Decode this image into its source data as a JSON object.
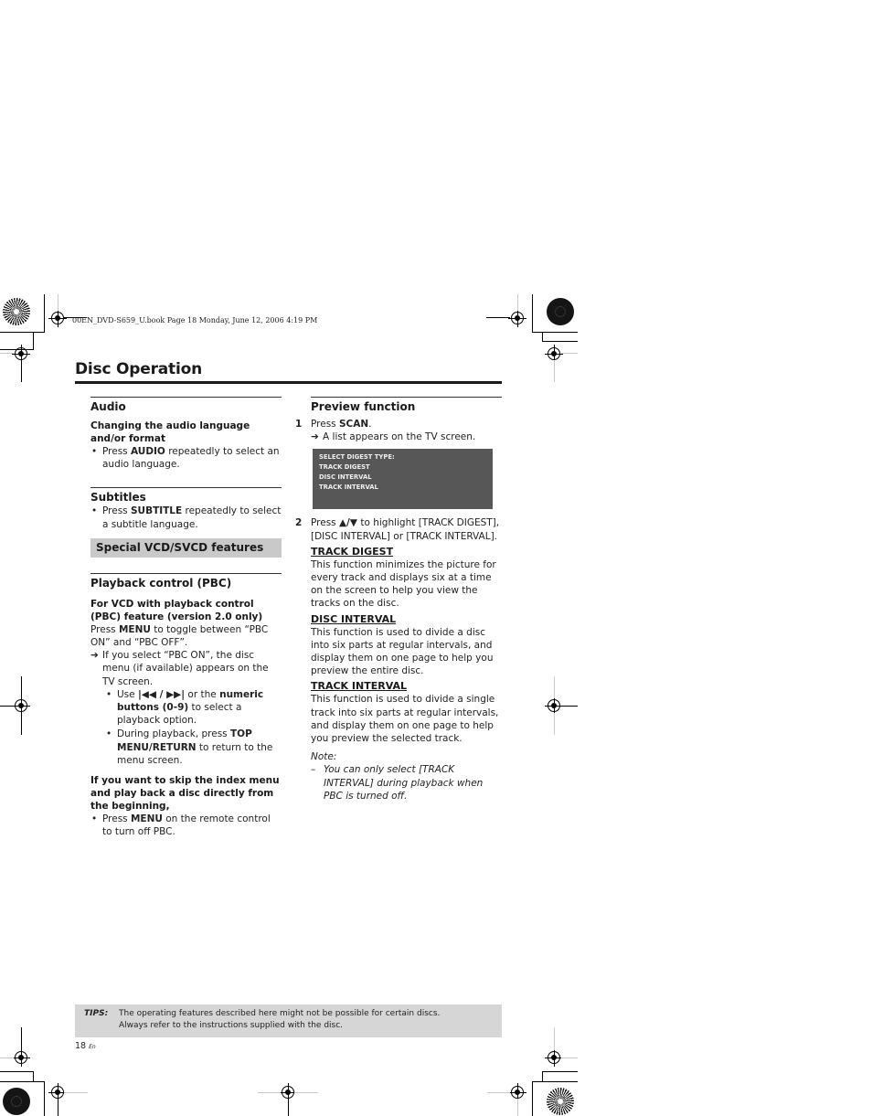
{
  "header": {
    "book_line": "00EN_DVD-S659_U.book  Page 18  Monday, June 12, 2006  4:19 PM"
  },
  "page_title": "Disc Operation",
  "left_column": {
    "audio": {
      "heading": "Audio",
      "subheading": "Changing the audio language and/or format",
      "bullet": {
        "pre": "Press ",
        "bold": "AUDIO",
        "post": " repeatedly to select an audio language."
      }
    },
    "subtitles": {
      "heading": "Subtitles",
      "bullet": {
        "pre": "Press ",
        "bold": "SUBTITLE",
        "post": " repeatedly to select a subtitle language."
      }
    },
    "special_band": "Special VCD/SVCD features",
    "pbc": {
      "heading": "Playback control (PBC)",
      "subheading": "For VCD with playback control (PBC) feature (version 2.0 only)",
      "intro": {
        "pre": "Press ",
        "bold": "MENU",
        "post": " to toggle between “PBC ON” and “PBC OFF”."
      },
      "arrow": "➔",
      "arrow_text": "If you select “PBC ON”, the disc menu (if available) appears on the TV screen.",
      "sub_bullets": [
        {
          "pre": "Use ",
          "icons": "⏮◀◀ / ▶▶⏭",
          "icons_display": "|◀◀ / ▶▶|",
          "mid": " or the ",
          "bold": "numeric buttons (0-9)",
          "post": " to select a playback option."
        },
        {
          "pre": "During playback, press ",
          "bold": "TOP MENU/RETURN",
          "post": " to return to the menu screen."
        }
      ],
      "skip_heading": "If you want to skip the index menu and play back a disc directly from the beginning,",
      "skip_bullet": {
        "pre": "Press ",
        "bold": "MENU",
        "post": " on the remote control to turn off PBC."
      }
    }
  },
  "right_column": {
    "preview": {
      "heading": "Preview function",
      "step1": {
        "num": "1",
        "pre": "Press ",
        "bold": "SCAN",
        "post": ".",
        "arrow": "➔",
        "arrow_text": "A list appears on the TV screen."
      },
      "osd_lines": [
        "SELECT DIGEST TYPE:",
        "TRACK DIGEST",
        "DISC INTERVAL",
        "TRACK INTERVAL"
      ],
      "step2": {
        "num": "2",
        "pre": "Press ",
        "bold": "▲/▼",
        "post": " to highlight [TRACK DIGEST], [DISC INTERVAL] or [TRACK INTERVAL]."
      },
      "options": [
        {
          "heading": "TRACK DIGEST",
          "text": "This function minimizes the picture for every track and displays six at a time on the screen to help you view the tracks on the disc."
        },
        {
          "heading": "DISC INTERVAL",
          "text": "This function is used to divide a disc into six parts at regular intervals, and display them on one page to help you preview the entire disc."
        },
        {
          "heading": "TRACK INTERVAL",
          "text": "This function is used to divide a single track into six parts at regular intervals, and display them on one page to help you preview the selected track."
        }
      ],
      "note_label": "Note:",
      "note_dash": "–",
      "note_text": "You can only select [TRACK INTERVAL] during playback when PBC is turned off."
    }
  },
  "tips": {
    "label": "TIPS:",
    "line1": "The operating features described here might not be possible for certain discs.",
    "line2": "Always refer to the instructions supplied with the disc."
  },
  "footer": {
    "page_number": "18",
    "lang": "En"
  }
}
